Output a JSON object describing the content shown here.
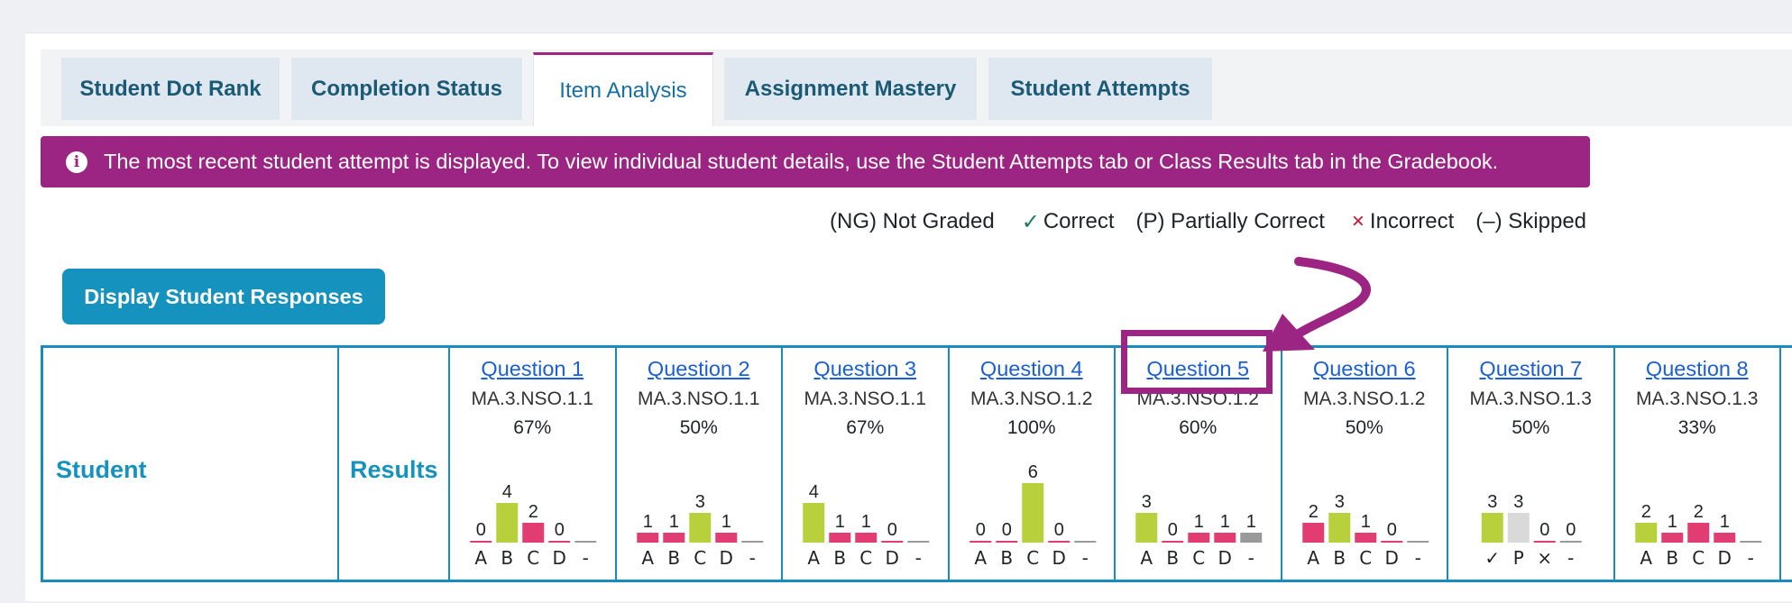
{
  "tabs": [
    {
      "label": "Student Dot Rank",
      "active": false
    },
    {
      "label": "Completion Status",
      "active": false
    },
    {
      "label": "Item Analysis",
      "active": true
    },
    {
      "label": "Assignment Mastery",
      "active": false
    },
    {
      "label": "Student Attempts",
      "active": false
    }
  ],
  "banner": {
    "icon": "info-icon",
    "text": "The most recent student attempt is displayed. To view individual student details, use the Student Attempts tab or Class Results tab in the Gradebook."
  },
  "legend": {
    "not_graded": "(NG) Not Graded",
    "correct_symbol": "✓",
    "correct": "Correct",
    "partial": "(P) Partially Correct",
    "incorrect_symbol": "×",
    "incorrect": "Incorrect",
    "skipped": "(–) Skipped"
  },
  "display_button": "Display Student Responses",
  "table": {
    "student_header": "Student",
    "results_header": "Results"
  },
  "colors": {
    "correct": "#b7d03b",
    "incorrect": "#e23d72",
    "partial": "#d9d9d9",
    "skipped": "#999999",
    "accent": "#9c2584",
    "link": "#1a5fd6"
  },
  "questions": [
    {
      "title": "Question 1",
      "standard": "MA.3.NSO.1.1",
      "percent": "67%",
      "bars": [
        {
          "label": "A",
          "value": 0,
          "type": "incorrect"
        },
        {
          "label": "B",
          "value": 4,
          "type": "correct"
        },
        {
          "label": "C",
          "value": 2,
          "type": "incorrect"
        },
        {
          "label": "D",
          "value": 0,
          "type": "incorrect"
        },
        {
          "label": "-",
          "value": null,
          "type": "skipped"
        }
      ]
    },
    {
      "title": "Question 2",
      "standard": "MA.3.NSO.1.1",
      "percent": "50%",
      "bars": [
        {
          "label": "A",
          "value": 1,
          "type": "incorrect"
        },
        {
          "label": "B",
          "value": 1,
          "type": "incorrect"
        },
        {
          "label": "C",
          "value": 3,
          "type": "correct"
        },
        {
          "label": "D",
          "value": 1,
          "type": "incorrect"
        },
        {
          "label": "-",
          "value": null,
          "type": "skipped"
        }
      ]
    },
    {
      "title": "Question 3",
      "standard": "MA.3.NSO.1.1",
      "percent": "67%",
      "bars": [
        {
          "label": "A",
          "value": 4,
          "type": "correct"
        },
        {
          "label": "B",
          "value": 1,
          "type": "incorrect"
        },
        {
          "label": "C",
          "value": 1,
          "type": "incorrect"
        },
        {
          "label": "D",
          "value": 0,
          "type": "incorrect"
        },
        {
          "label": "-",
          "value": null,
          "type": "skipped"
        }
      ]
    },
    {
      "title": "Question 4",
      "standard": "MA.3.NSO.1.2",
      "percent": "100%",
      "bars": [
        {
          "label": "A",
          "value": 0,
          "type": "incorrect"
        },
        {
          "label": "B",
          "value": 0,
          "type": "incorrect"
        },
        {
          "label": "C",
          "value": 6,
          "type": "correct"
        },
        {
          "label": "D",
          "value": 0,
          "type": "incorrect"
        },
        {
          "label": "-",
          "value": null,
          "type": "skipped"
        }
      ]
    },
    {
      "title": "Question 5",
      "standard": "MA.3.NSO.1.2",
      "percent": "60%",
      "bars": [
        {
          "label": "A",
          "value": 3,
          "type": "correct"
        },
        {
          "label": "B",
          "value": 0,
          "type": "incorrect"
        },
        {
          "label": "C",
          "value": 1,
          "type": "incorrect"
        },
        {
          "label": "D",
          "value": 1,
          "type": "incorrect"
        },
        {
          "label": "-",
          "value": 1,
          "type": "skipped"
        }
      ]
    },
    {
      "title": "Question 6",
      "standard": "MA.3.NSO.1.2",
      "percent": "50%",
      "bars": [
        {
          "label": "A",
          "value": 2,
          "type": "incorrect"
        },
        {
          "label": "B",
          "value": 3,
          "type": "correct"
        },
        {
          "label": "C",
          "value": 1,
          "type": "incorrect"
        },
        {
          "label": "D",
          "value": 0,
          "type": "incorrect"
        },
        {
          "label": "-",
          "value": null,
          "type": "skipped"
        }
      ]
    },
    {
      "title": "Question 7",
      "standard": "MA.3.NSO.1.3",
      "percent": "50%",
      "bars": [
        {
          "label": "✓",
          "value": 3,
          "type": "correct"
        },
        {
          "label": "P",
          "value": 3,
          "type": "partial"
        },
        {
          "label": "×",
          "value": 0,
          "type": "incorrect"
        },
        {
          "label": "-",
          "value": 0,
          "type": "skipped"
        }
      ]
    },
    {
      "title": "Question 8",
      "standard": "MA.3.NSO.1.3",
      "percent": "33%",
      "bars": [
        {
          "label": "A",
          "value": 2,
          "type": "correct"
        },
        {
          "label": "B",
          "value": 1,
          "type": "incorrect"
        },
        {
          "label": "C",
          "value": 2,
          "type": "incorrect"
        },
        {
          "label": "D",
          "value": 1,
          "type": "incorrect"
        },
        {
          "label": "-",
          "value": null,
          "type": "skipped"
        }
      ]
    }
  ]
}
